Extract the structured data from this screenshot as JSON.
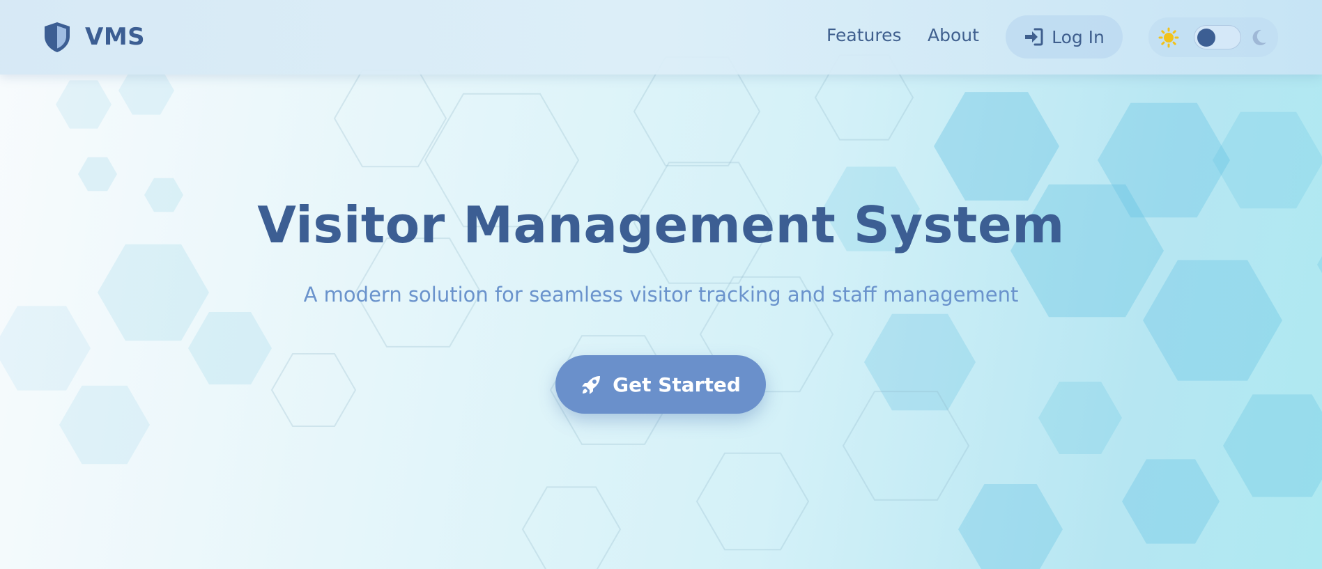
{
  "app": {
    "brand": "VMS"
  },
  "nav": {
    "features": "Features",
    "about": "About",
    "login": "Log In"
  },
  "theme": {
    "mode": "light",
    "sun_icon": "sun-icon",
    "moon_icon": "moon-icon"
  },
  "hero": {
    "title": "Visitor Management System",
    "subtitle": "A modern solution for seamless visitor tracking and staff management",
    "cta": "Get Started",
    "cta_icon": "rocket-icon"
  },
  "colors": {
    "primary": "#3c5e93",
    "accent": "#6a90cb",
    "subtitle": "#6a93cc",
    "sun": "#f2c21a"
  }
}
